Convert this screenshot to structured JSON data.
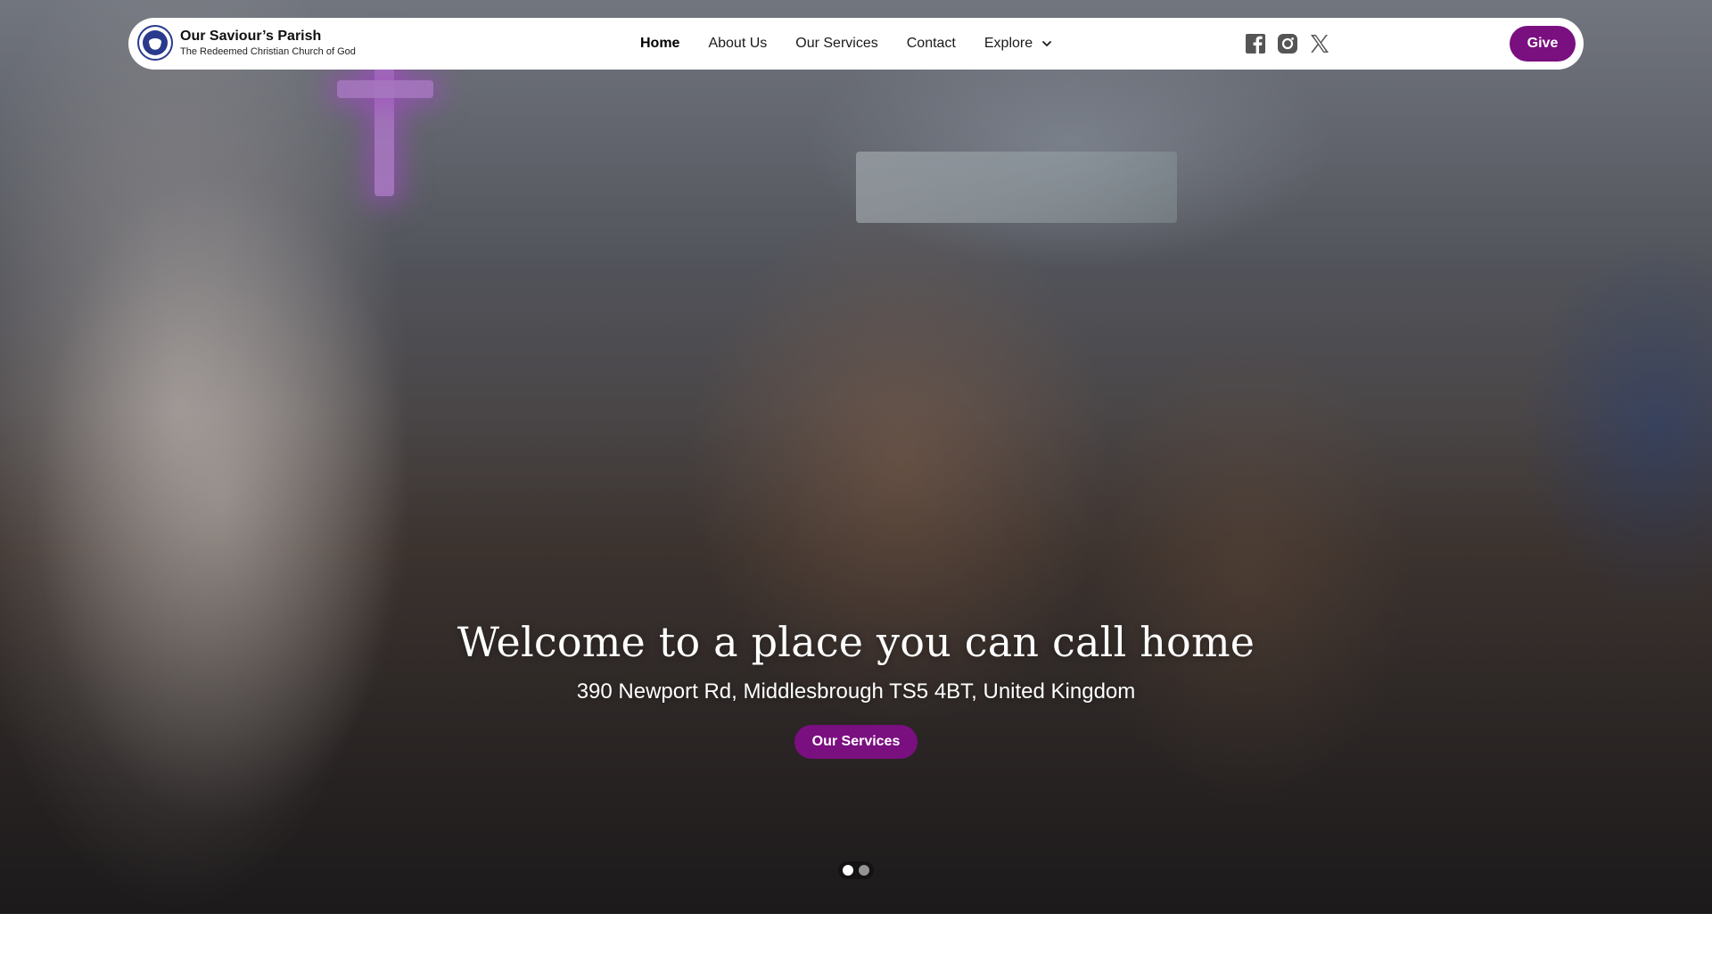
{
  "brand": {
    "title": "Our Saviour’s Parish",
    "subtitle": "The Redeemed Christian Church of God",
    "logo_icon": "rccg-logo-icon"
  },
  "nav": {
    "items": [
      {
        "label": "Home",
        "active": true
      },
      {
        "label": "About Us",
        "active": false
      },
      {
        "label": "Our Services",
        "active": false
      },
      {
        "label": "Contact",
        "active": false
      }
    ],
    "explore": {
      "label": "Explore",
      "icon": "chevron-down-icon"
    }
  },
  "social": {
    "icons": [
      "facebook-icon",
      "instagram-icon",
      "x-twitter-icon"
    ]
  },
  "give_button": {
    "label": "Give"
  },
  "hero": {
    "title": "Welcome to a place you can call home",
    "address": "390 Newport Rd, Middlesbrough TS5 4BT, United Kingdom",
    "cta_label": "Our Services",
    "slides_total": 2,
    "active_slide": 1
  },
  "colors": {
    "accent": "#7a0f80",
    "nav_bg": "#ffffff",
    "text_dark": "#111111",
    "icon_gray": "#555555"
  }
}
